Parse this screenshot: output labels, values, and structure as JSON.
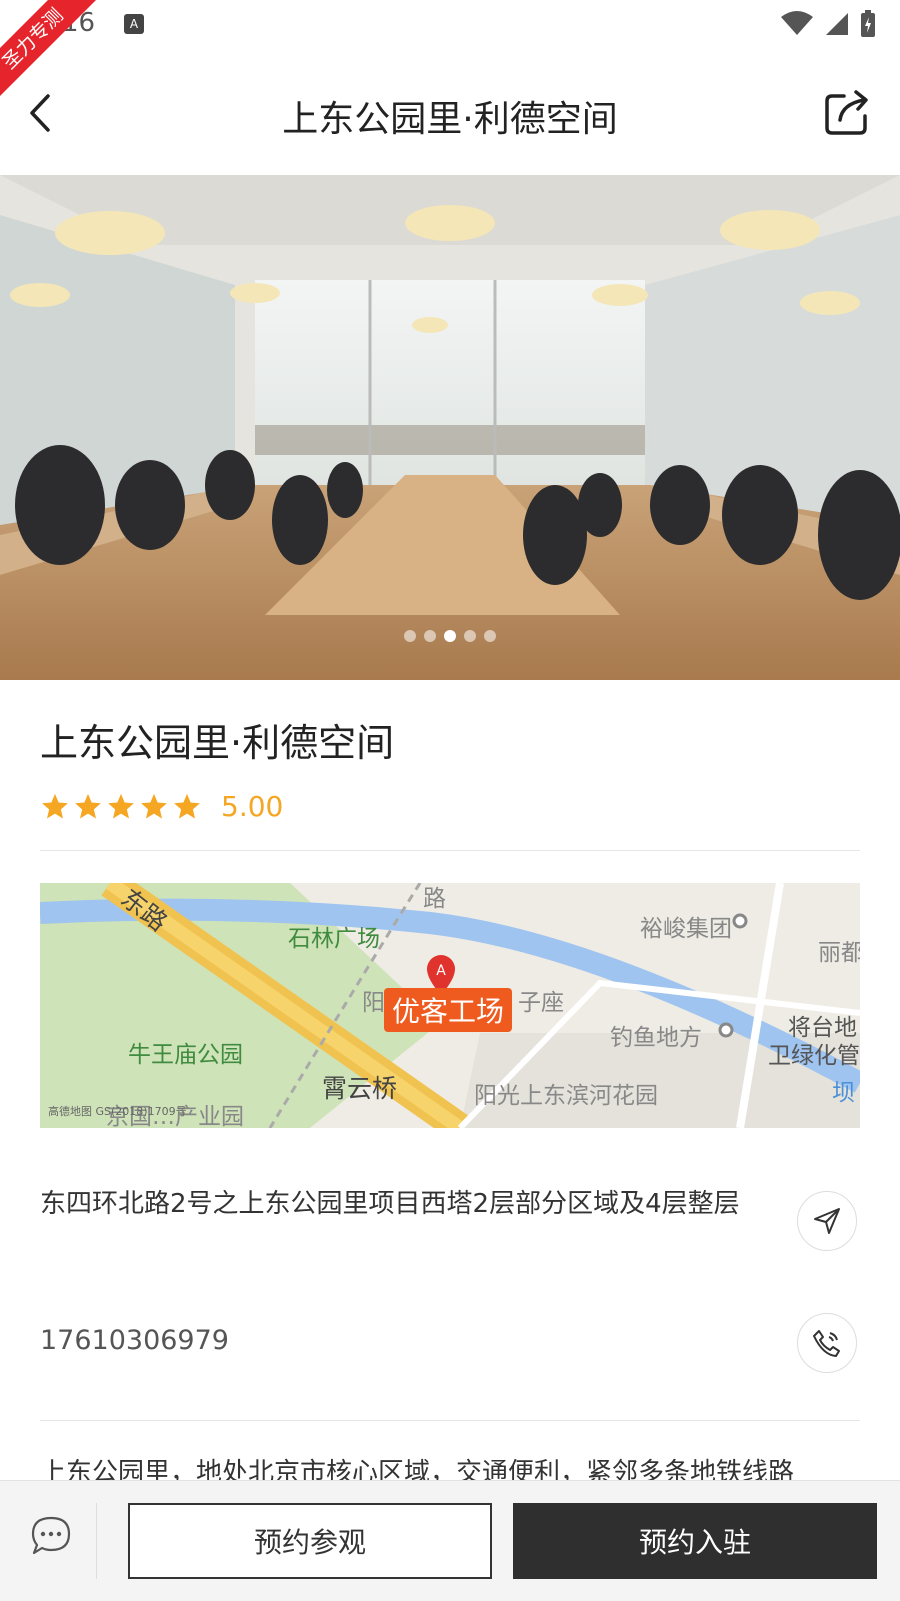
{
  "status_bar": {
    "time": "16",
    "a_badge": "A"
  },
  "ribbon": {
    "text": "圣力专测",
    "color": "#e5242b"
  },
  "nav": {
    "title": "上东公园里·利德空间"
  },
  "gallery": {
    "total": 5,
    "active_index": 2
  },
  "space": {
    "name": "上东公园里·利德空间",
    "rating": "5.00",
    "stars": 5
  },
  "map": {
    "labels": {
      "road_top": "东路",
      "park1": "石林广场",
      "poi1": "裕峻集团",
      "poi2": "丽都",
      "poi3": "子座",
      "poi_near": "阳",
      "pin": "优客工场",
      "poi4": "钓鱼地方",
      "poi5": "将台地",
      "poi6": "卫绿化管",
      "park2": "牛王庙公园",
      "road2": "霄云桥",
      "poi7": "阳光上东滨河花园",
      "poi8": "京国…产业园",
      "river": "坝",
      "road_diag": "路",
      "footer": "高德地图 GS(2018)1709号"
    }
  },
  "address": {
    "text": "东四环北路2号之上东公园里项目西塔2层部分区域及4层整层"
  },
  "phone": {
    "number": "17610306979"
  },
  "description": {
    "text": "上东公园里，地处北京市核心区域，交通便利，紧邻多条地铁线路"
  },
  "bottom": {
    "visit_label": "预约参观",
    "settle_label": "预约入驻"
  },
  "colors": {
    "accent": "#f5a623",
    "dark_button": "#2f2f2f",
    "pin": "#ef5a1f"
  }
}
